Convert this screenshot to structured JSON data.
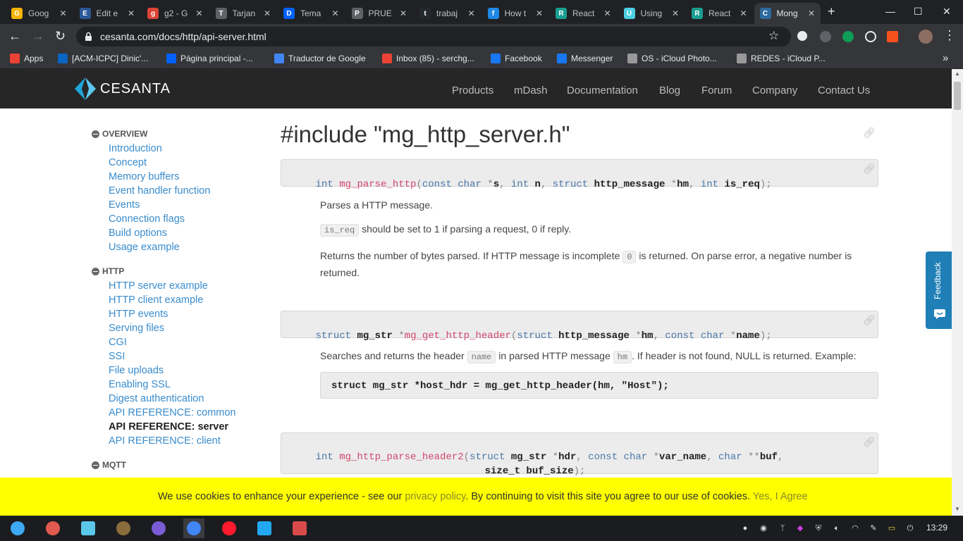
{
  "browser": {
    "tabs": [
      {
        "title": "Goog",
        "favicon": "G",
        "color": "#f4b400"
      },
      {
        "title": "Edit e",
        "favicon": "E",
        "color": "#2b5797"
      },
      {
        "title": "g2 - G",
        "favicon": "g",
        "color": "#db4437"
      },
      {
        "title": "Tarjan",
        "favicon": "T",
        "color": "#5f6368"
      },
      {
        "title": "Tema",
        "favicon": "D",
        "color": "#0061fe"
      },
      {
        "title": "PRUE",
        "favicon": "P",
        "color": "#5f6368"
      },
      {
        "title": "trabaj",
        "favicon": "t",
        "color": "#24292e"
      },
      {
        "title": "How t",
        "favicon": "f",
        "color": "#1e88e5"
      },
      {
        "title": "React",
        "favicon": "R",
        "color": "#1a9e8f"
      },
      {
        "title": "Using",
        "favicon": "U",
        "color": "#4dd0e1"
      },
      {
        "title": "React",
        "favicon": "R",
        "color": "#1a9e8f"
      },
      {
        "title": "Mong",
        "favicon": "C",
        "color": "#2d6a9f"
      }
    ],
    "new_tab": "+",
    "window_controls": {
      "minimize": "—",
      "maximize": "☐",
      "close": "✕"
    },
    "url": "cesanta.com/docs/http/api-server.html",
    "bookmarks": [
      {
        "label": "Apps",
        "icon": "apps-grid-icon",
        "color": "#ea4335"
      },
      {
        "label": "[ACM-ICPC] Dinic'...",
        "icon": "linkedin-icon",
        "color": "#0a66c2"
      },
      {
        "label": "Página principal -...",
        "icon": "dropbox-icon",
        "color": "#0061fe"
      },
      {
        "label": "Traductor de Google",
        "icon": "translate-icon",
        "color": "#4285f4"
      },
      {
        "label": "Inbox (85) - serchg...",
        "icon": "gmail-icon",
        "color": "#ea4335"
      },
      {
        "label": "Facebook",
        "icon": "facebook-icon",
        "color": "#1877f2"
      },
      {
        "label": "Messenger",
        "icon": "facebook-icon",
        "color": "#1877f2"
      },
      {
        "label": "OS - iCloud Photo...",
        "icon": "apple-icon",
        "color": "#999999"
      },
      {
        "label": "REDES - iCloud P...",
        "icon": "apple-icon",
        "color": "#999999"
      }
    ],
    "bookmarks_overflow": "»"
  },
  "site": {
    "logo": "CESANTA",
    "nav": [
      "Products",
      "mDash",
      "Documentation",
      "Blog",
      "Forum",
      "Company",
      "Contact Us"
    ]
  },
  "sidebar": {
    "sections": [
      {
        "title": "OVERVIEW",
        "items": [
          "Introduction",
          "Concept",
          "Memory buffers",
          "Event handler function",
          "Events",
          "Connection flags",
          "Build options",
          "Usage example"
        ]
      },
      {
        "title": "HTTP",
        "items": [
          "HTTP server example",
          "HTTP client example",
          "HTTP events",
          "Serving files",
          "CGI",
          "SSI",
          "File uploads",
          "Enabling SSL",
          "Digest authentication",
          "API REFERENCE: common",
          "API REFERENCE: server",
          "API REFERENCE: client"
        ]
      },
      {
        "title": "MQTT",
        "items": []
      }
    ],
    "current": "API REFERENCE: server"
  },
  "main": {
    "heading": "#include \"mg_http_server.h\"",
    "fn1": {
      "t1": "int",
      "name": "mg_parse_http",
      "p1": "(",
      "t2": "const char",
      "p2": " *",
      "a1": "s",
      "c1": ", ",
      "t3": "int",
      "a2": "n",
      "c2": ", ",
      "t4": "struct",
      "a3": "http_message",
      "p3": " *",
      "a4": "hm",
      "c3": ", ",
      "t5": "int",
      "a5": "is_req",
      "p4": ");"
    },
    "desc1": {
      "line1": "Parses a HTTP message.",
      "code_is_req": "is_req",
      "line2": " should be set to 1 if parsing a request, 0 if reply.",
      "line3a": "Returns the number of bytes parsed. If HTTP message is incomplete ",
      "code_zero": "0",
      "line3b": " is returned. On parse error, a negative number is",
      "line3c": "returned."
    },
    "fn2": {
      "t1": "struct",
      "a1": "mg_str",
      "p1": " *",
      "name": "mg_get_http_header",
      "p2": "(",
      "t2": "struct",
      "a2": "http_message",
      "p3": " *",
      "a3": "hm",
      "c1": ", ",
      "t3": "const char",
      "p4": " *",
      "a4": "name",
      "p5": ");"
    },
    "desc2": {
      "a": "Searches and returns the header ",
      "code_name": "name",
      "b": " in parsed HTTP message ",
      "code_hm": "hm",
      "c": ". If header is not found, NULL is returned. Example:"
    },
    "example": "struct mg_str *host_hdr = mg_get_http_header(hm, \"Host\");",
    "fn3": {
      "t1": "int",
      "name": "mg_http_parse_header2",
      "p1": "(",
      "t2": "struct",
      "a1": "mg_str",
      "p2": " *",
      "a2": "hdr",
      "c1": ", ",
      "t3": "const char",
      "p3": " *",
      "a3": "var_name",
      "c2": ", ",
      "t4": "char",
      "p4": " **",
      "a4": "buf",
      "c3": ",",
      "line2": "size_t buf_size",
      "p5": ");"
    }
  },
  "feedback": "Feedback",
  "cookie": {
    "text_a": "We use cookies to enhance your experience - see our ",
    "link": "privacy policy",
    "text_b": ". By continuing to visit this site you agree to our use of cookies. ",
    "agree": "Yes, I Agree"
  },
  "taskbar": {
    "apps": [
      {
        "name": "launcher-icon",
        "color": "#3da9f5"
      },
      {
        "name": "screen-recorder-icon",
        "color": "#e05a4f"
      },
      {
        "name": "files-icon",
        "color": "#5ac8e8"
      },
      {
        "name": "s-app-icon",
        "color": "#8a6d3b"
      },
      {
        "name": "system-monitor-icon",
        "color": "#7b5cd6"
      },
      {
        "name": "chrome-icon",
        "color": "#4285f4"
      },
      {
        "name": "opera-icon",
        "color": "#ff1b2d"
      },
      {
        "name": "vscode-icon",
        "color": "#23a9f2"
      },
      {
        "name": "terminal-icon",
        "color": "#d94b4b"
      }
    ],
    "clock": "13:29"
  }
}
